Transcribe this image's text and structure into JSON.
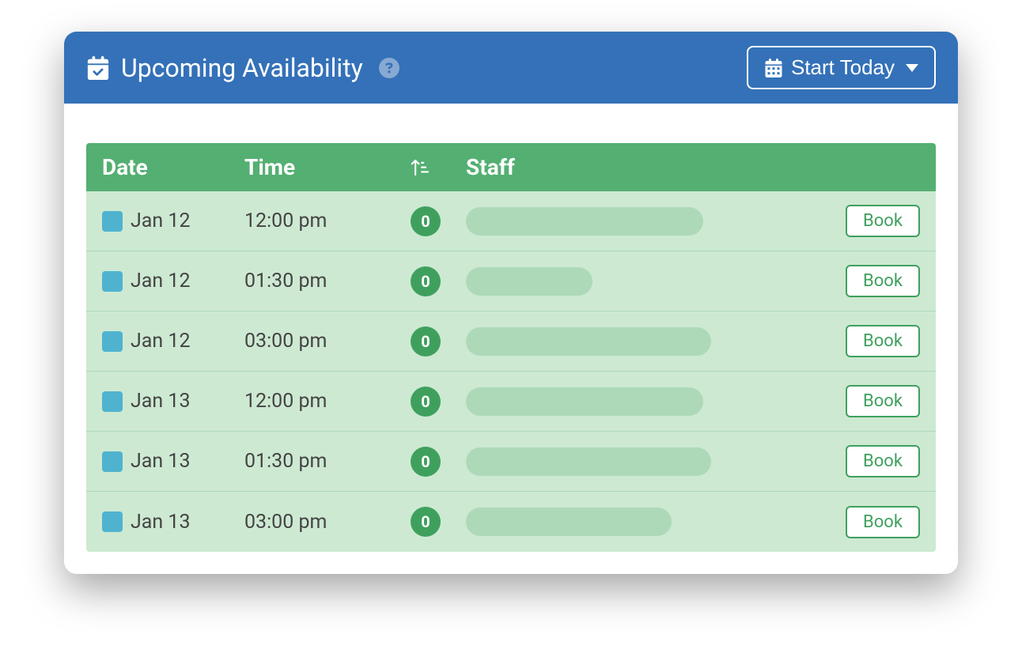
{
  "header": {
    "title": "Upcoming Availability",
    "start_today_label": "Start Today"
  },
  "table": {
    "columns": {
      "date": "Date",
      "time": "Time",
      "staff": "Staff"
    },
    "book_label": "Book",
    "rows": [
      {
        "date": "Jan 12",
        "time": "12:00 pm",
        "count": "0",
        "staff_width": 300
      },
      {
        "date": "Jan 12",
        "time": "01:30 pm",
        "count": "0",
        "staff_width": 160
      },
      {
        "date": "Jan 12",
        "time": "03:00 pm",
        "count": "0",
        "staff_width": 310
      },
      {
        "date": "Jan 13",
        "time": "12:00 pm",
        "count": "0",
        "staff_width": 300
      },
      {
        "date": "Jan 13",
        "time": "01:30 pm",
        "count": "0",
        "staff_width": 310
      },
      {
        "date": "Jan 13",
        "time": "03:00 pm",
        "count": "0",
        "staff_width": 260
      }
    ]
  },
  "colors": {
    "header_bg": "#3471B8",
    "table_head_bg": "#54AF72",
    "row_bg": "#CDE9D2",
    "badge_bg": "#3FA05E",
    "swatch": "#4FB3CF",
    "placeholder": "#ADD9B9"
  }
}
